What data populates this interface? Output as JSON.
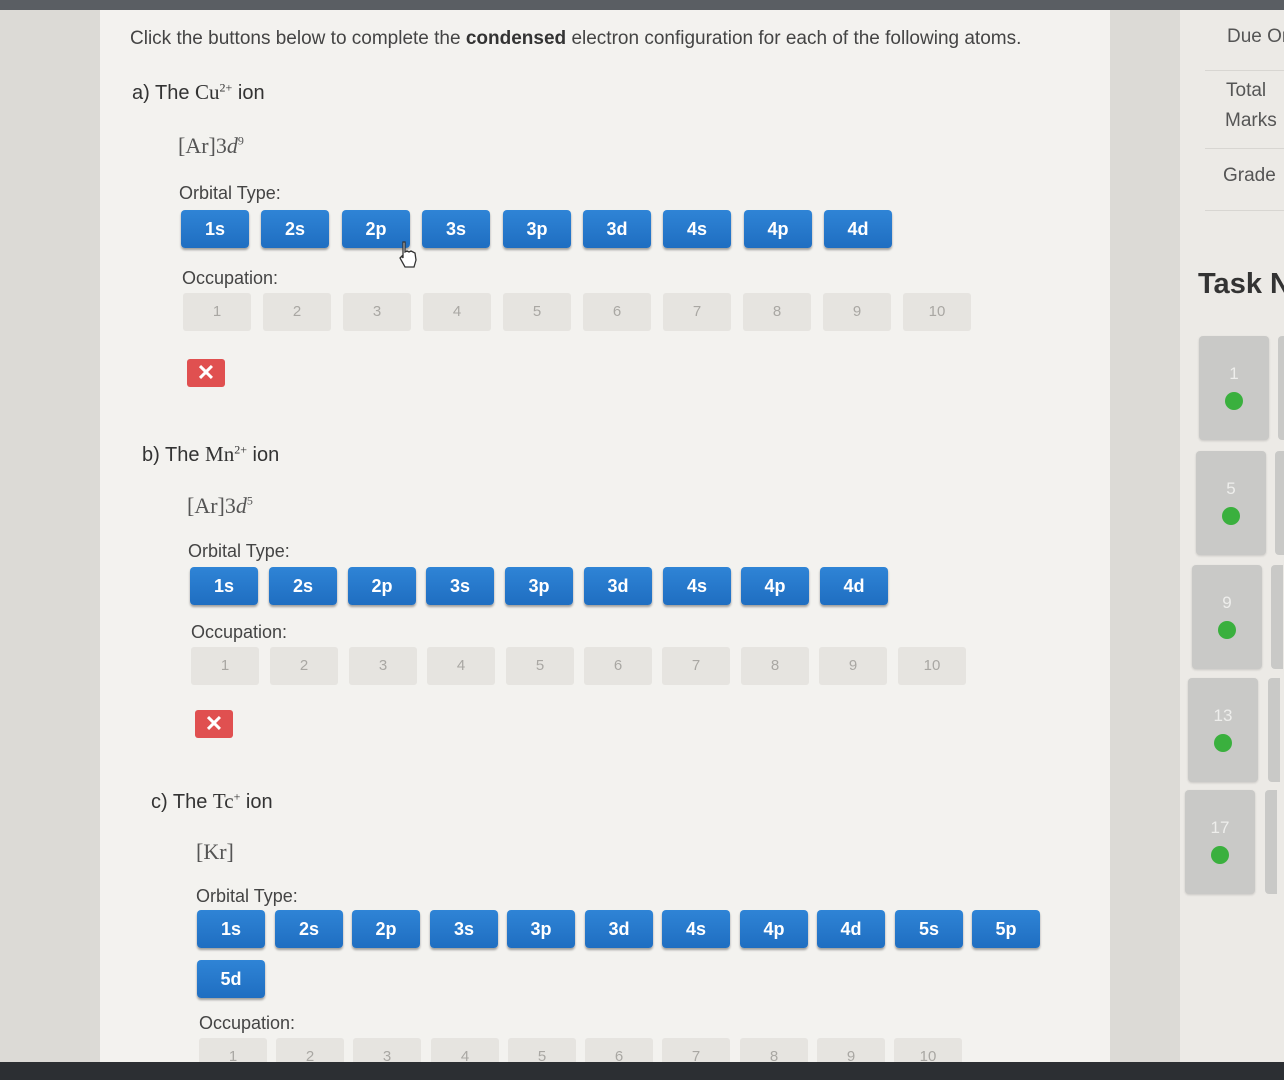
{
  "instructions": {
    "before": "Click the buttons below to complete the ",
    "bold": "condensed",
    "after": " electron configuration for each of the following atoms."
  },
  "labels": {
    "orbital_type": "Orbital Type:",
    "occupation": "Occupation:"
  },
  "questions": [
    {
      "prefix": "a) The",
      "species": "Cu",
      "charge": "2+",
      "suffix": "ion",
      "config": {
        "core": "[Ar]",
        "coeff": "3",
        "sub": "d",
        "exp": "9"
      },
      "orbitals": [
        "1s",
        "2s",
        "2p",
        "3s",
        "3p",
        "3d",
        "4s",
        "4p",
        "4d"
      ],
      "occupations": [
        "1",
        "2",
        "3",
        "4",
        "5",
        "6",
        "7",
        "8",
        "9",
        "10"
      ],
      "remove_symbol": "✕"
    },
    {
      "prefix": "b) The",
      "species": "Mn",
      "charge": "2+",
      "suffix": "ion",
      "config": {
        "core": "[Ar]",
        "coeff": "3",
        "sub": "d",
        "exp": "5"
      },
      "orbitals": [
        "1s",
        "2s",
        "2p",
        "3s",
        "3p",
        "3d",
        "4s",
        "4p",
        "4d"
      ],
      "occupations": [
        "1",
        "2",
        "3",
        "4",
        "5",
        "6",
        "7",
        "8",
        "9",
        "10"
      ],
      "remove_symbol": "✕"
    },
    {
      "prefix": "c) The",
      "species": "Tc",
      "charge": "+",
      "suffix": "ion",
      "config": {
        "core": "[Kr]",
        "coeff": "",
        "sub": "",
        "exp": ""
      },
      "orbitals": [
        "1s",
        "2s",
        "2p",
        "3s",
        "3p",
        "3d",
        "4s",
        "4p",
        "4d",
        "5s",
        "5p",
        "5d"
      ],
      "occupations": [
        "1",
        "2",
        "3",
        "4",
        "5",
        "6",
        "7",
        "8",
        "9",
        "10"
      ]
    }
  ],
  "right_panel": {
    "due": "Due On",
    "total_marks_1": "Total",
    "total_marks_2": "Marks",
    "grade": "Grade",
    "task_heading": "Task N",
    "tasks": [
      {
        "num": "1",
        "status": "complete"
      },
      {
        "num": "5",
        "status": "complete"
      },
      {
        "num": "9",
        "status": "complete"
      },
      {
        "num": "13",
        "status": "complete"
      },
      {
        "num": "17",
        "status": "complete"
      }
    ]
  },
  "colors": {
    "orbital_button": "#2277c9",
    "occupation_button": "#e6e4e0",
    "remove_button": "#e05050",
    "task_status_dot": "#3ab03e"
  },
  "icons": {
    "cursor": "hand-pointer-icon",
    "remove": "close-icon"
  }
}
